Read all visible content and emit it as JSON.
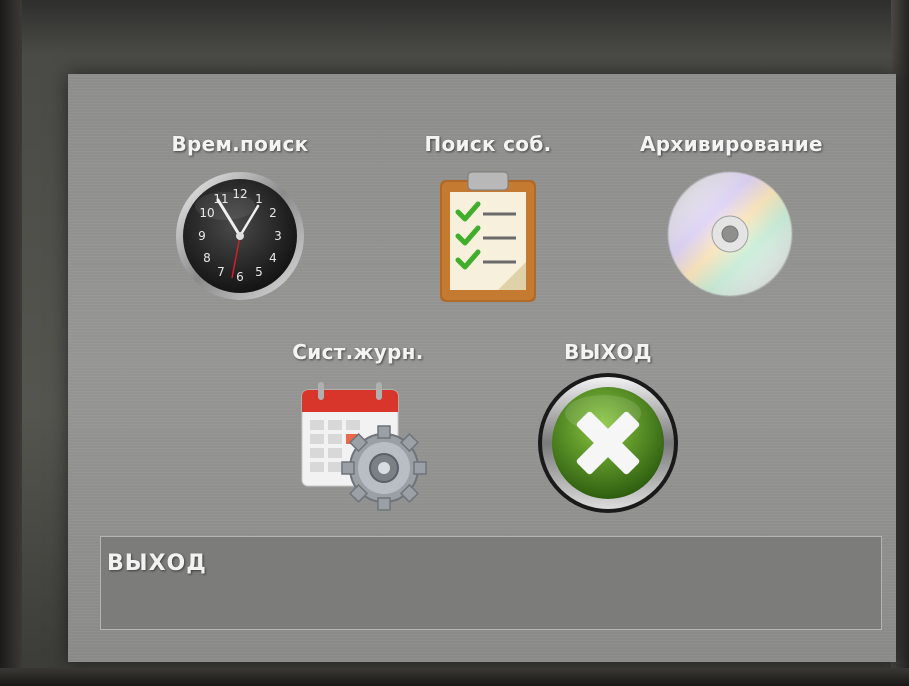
{
  "menu": {
    "items": [
      {
        "label": "Врем.поиск",
        "icon": "clock-icon"
      },
      {
        "label": "Поиск соб.",
        "icon": "clipboard-checklist-icon"
      },
      {
        "label": "Архивирование",
        "icon": "cd-disc-icon"
      },
      {
        "label": "Сист.журн.",
        "icon": "calendar-gear-icon"
      },
      {
        "label": "ВЫХОД",
        "icon": "exit-x-icon"
      }
    ]
  },
  "clock": {
    "numerals": [
      "12",
      "1",
      "2",
      "3",
      "4",
      "5",
      "6",
      "7",
      "8",
      "9",
      "10",
      "11"
    ]
  },
  "status_bar": {
    "text": "ВЫХОД"
  },
  "colors": {
    "panel": "#8f8f8d",
    "exit_green": "#4e8a1e",
    "calendar_red": "#d8362a",
    "check_green": "#3fae2a"
  }
}
